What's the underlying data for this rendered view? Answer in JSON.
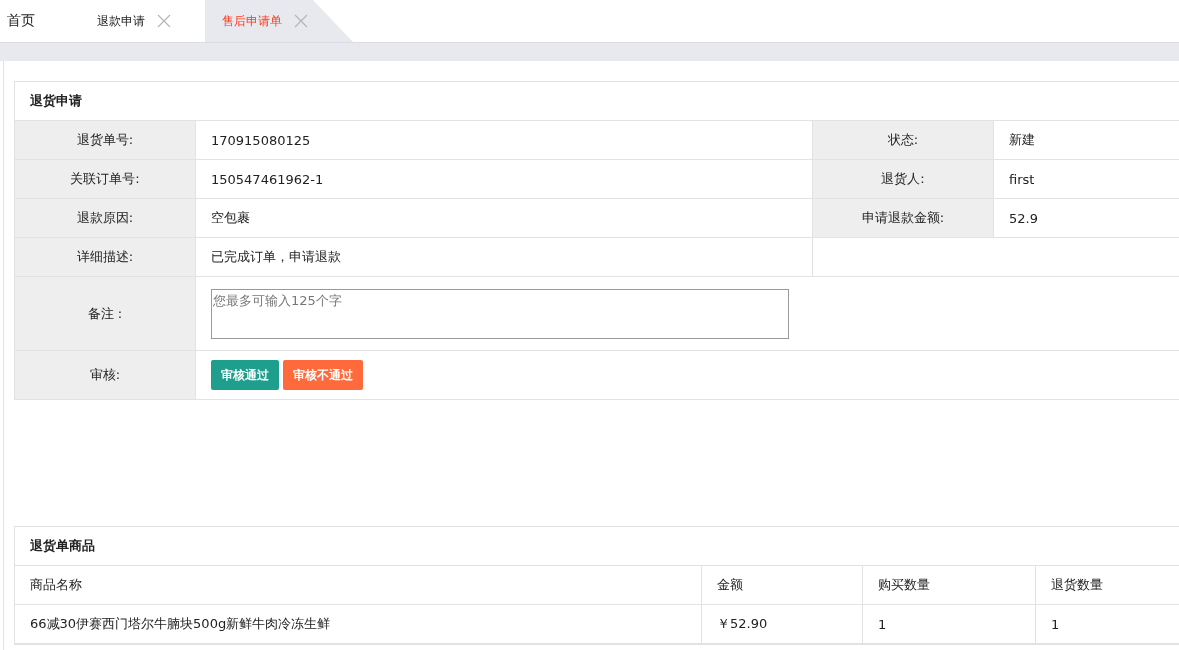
{
  "tabs": [
    {
      "label": "首页",
      "selected": false,
      "closable": false
    },
    {
      "label": "退款申请",
      "selected": false,
      "closable": true
    },
    {
      "label": "售后申请单",
      "selected": true,
      "closable": true
    }
  ],
  "return_form": {
    "title": "退货申请",
    "rows": [
      {
        "kind": "text",
        "fields": [
          {
            "label": "退货单号:",
            "value": "170915080125"
          },
          {
            "label": "状态:",
            "value": "新建"
          }
        ]
      },
      {
        "kind": "text",
        "fields": [
          {
            "label": "关联订单号:",
            "value": "150547461962-1"
          },
          {
            "label": "退货人:",
            "value": "first"
          }
        ]
      },
      {
        "kind": "text",
        "fields": [
          {
            "label": "退款原因:",
            "value": "空包裹"
          },
          {
            "label": "申请退款金额:",
            "value": "52.9"
          }
        ]
      },
      {
        "kind": "text",
        "fields": [
          {
            "label": "详细描述:",
            "value": "已完成订单，申请退款"
          }
        ]
      },
      {
        "kind": "textarea",
        "label": "备注 :",
        "placeholder": "您最多可输入125个字"
      },
      {
        "kind": "buttons",
        "label": "审核:",
        "buttons": [
          {
            "label": "审核通过",
            "kind": "approve"
          },
          {
            "label": "审核不通过",
            "kind": "reject"
          }
        ]
      }
    ]
  },
  "items_table": {
    "title": "退货单商品",
    "columns": [
      "商品名称",
      "金额",
      "购买数量",
      "退货数量"
    ],
    "rows": [
      [
        "66减30伊赛西门塔尔牛腩块500g新鲜牛肉冷冻生鲜",
        "￥52.90",
        "1",
        "1"
      ]
    ]
  }
}
